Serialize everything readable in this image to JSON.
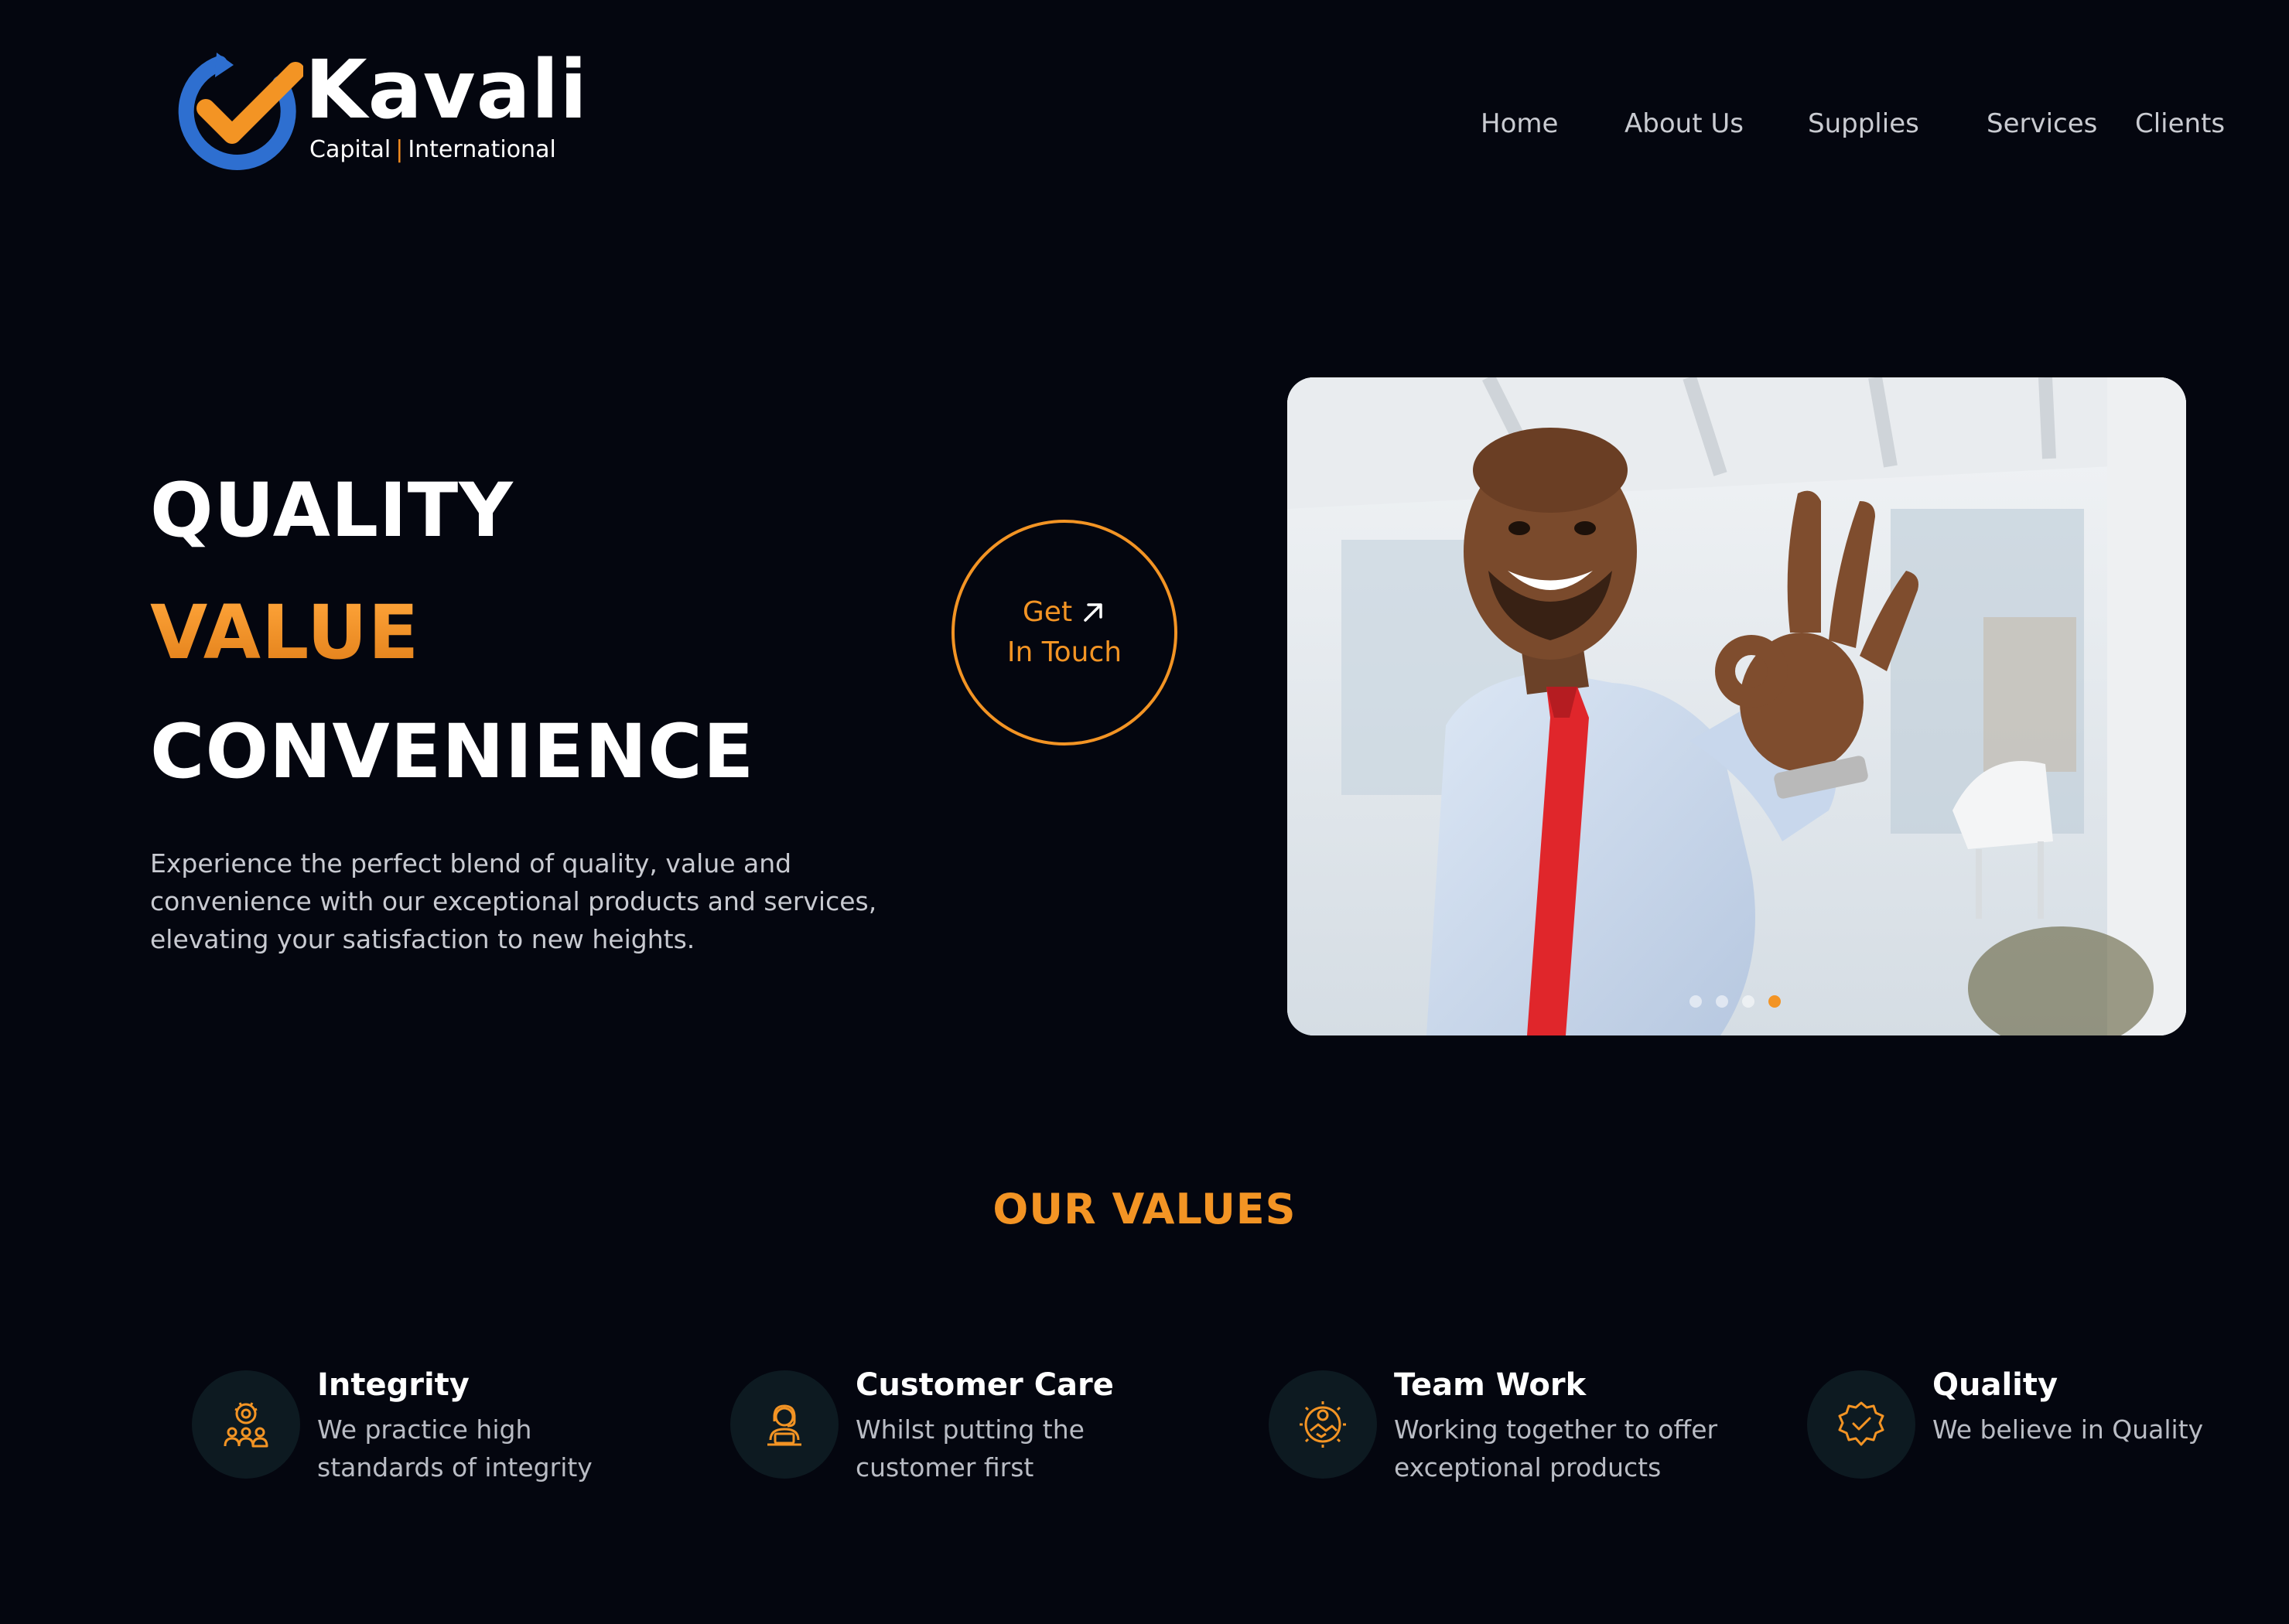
{
  "brand": {
    "name": "Kavali",
    "tagline_left": "Capital",
    "tagline_sep": "|",
    "tagline_right": "International",
    "colors": {
      "orange": "#f39424",
      "blue": "#2e6fd0",
      "background": "#04060f"
    }
  },
  "nav": {
    "items": [
      {
        "label": "Home"
      },
      {
        "label": "About Us"
      },
      {
        "label": "Supplies"
      },
      {
        "label": "Services"
      },
      {
        "label": "Clients"
      }
    ]
  },
  "hero": {
    "word1": "QUALITY",
    "word2": "VALUE",
    "word3": "CONVENIENCE",
    "description": "Experience the perfect blend of quality, value and convenience with our exceptional products and services, elevating your satisfaction to new heights.",
    "cta_line1": "Get",
    "cta_line2": "In Touch",
    "cta_icon": "arrow-up-right-icon",
    "image_subject": "smiling-businessman-ok-gesture",
    "carousel": {
      "count": 4,
      "active_index": 3
    }
  },
  "values": {
    "heading": "OUR VALUES",
    "items": [
      {
        "title": "Integrity",
        "description": "We practice high standards of integrity",
        "icon": "award-team-icon"
      },
      {
        "title": "Customer Care",
        "description": "Whilst putting the customer first",
        "icon": "support-agent-icon"
      },
      {
        "title": "Team Work",
        "description": "Working together to offer exceptional products",
        "icon": "handshake-gear-icon"
      },
      {
        "title": "Quality",
        "description": "We believe in Quality",
        "icon": "verified-badge-icon"
      }
    ]
  }
}
